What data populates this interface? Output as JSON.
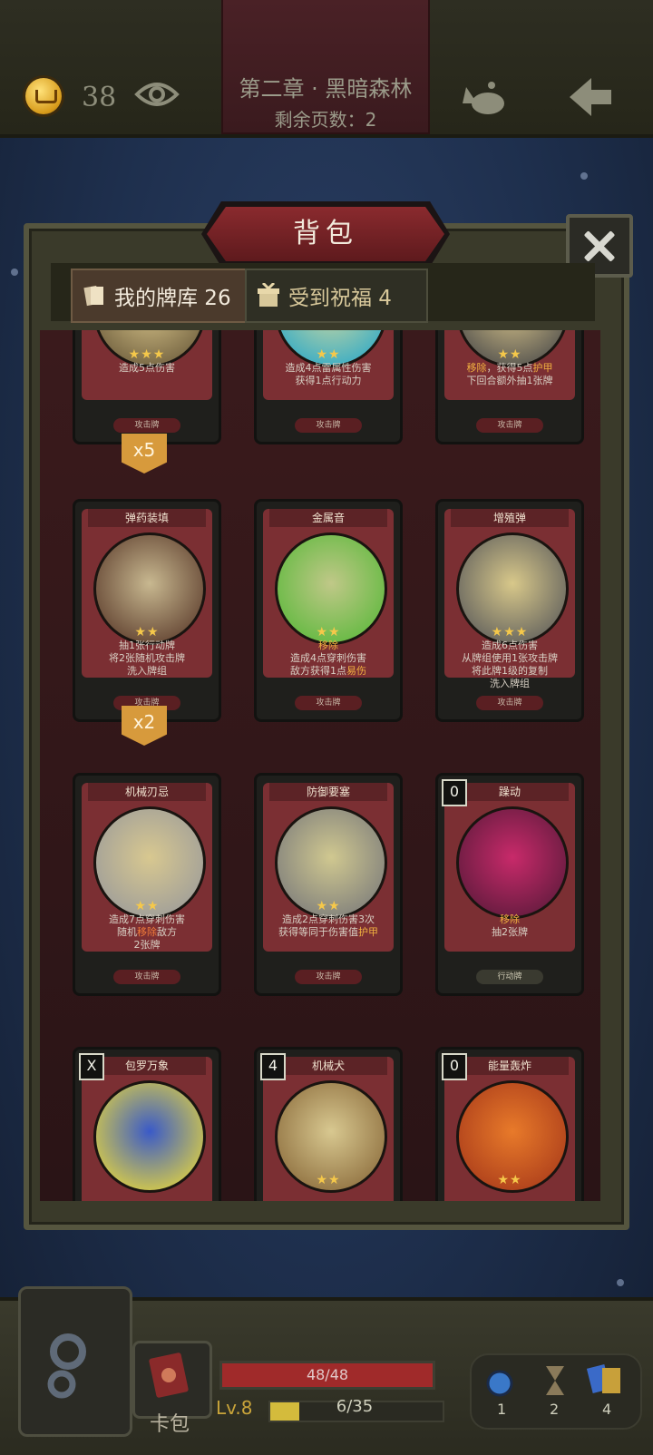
{
  "header": {
    "coins": "38",
    "chapter_title": "第二章 · 黑暗森林",
    "pages_left": "剩余页数：2"
  },
  "panel": {
    "title": "背包",
    "tabs": [
      {
        "label": "我的牌库 26"
      },
      {
        "label": "受到祝福 4"
      }
    ]
  },
  "cards": [
    {
      "name": "",
      "stars": "★★★",
      "desc_html": "造成5点伤害",
      "type": "攻击牌"
    },
    {
      "name": "",
      "stars": "★★",
      "desc_html": "造成4点雷属性伤害<br>获得1点行动力",
      "type": "攻击牌"
    },
    {
      "name": "",
      "stars": "★★",
      "desc_html": "<span class=\"hl\">移除</span>，获得5点<span class=\"hl\">护甲</span><br>下回合额外抽1张牌",
      "type": "攻击牌"
    },
    {
      "name": "弹药装填",
      "stars": "★★",
      "desc_html": "抽1张行动牌<br>将2张随机攻击牌<br>洗入牌组",
      "type": "攻击牌"
    },
    {
      "name": "金属音",
      "stars": "★★",
      "desc_html": "<span class=\"hl\">移除</span><br>造成4点穿刺伤害<br>敌方获得1点<span class=\"hl\">易伤</span>",
      "type": "攻击牌"
    },
    {
      "name": "增殖弹",
      "stars": "★★★",
      "desc_html": "造成6点伤害<br>从牌组使用1张攻击牌<br>将此牌1级的复制<br>洗入牌组",
      "type": "攻击牌"
    },
    {
      "name": "机械刃忌",
      "stars": "★★",
      "desc_html": "造成7点穿刺伤害<br>随机<span class=\"hl-red\">移除</span>敌方<br>2张牌",
      "type": "攻击牌"
    },
    {
      "name": "防御要塞",
      "stars": "★★",
      "desc_html": "造成2点穿刺伤害3次<br>获得等同于伤害值<span class=\"hl\">护甲</span>",
      "type": "攻击牌"
    },
    {
      "name": "躁动",
      "cost": "0",
      "stars": "",
      "desc_html": "<span class=\"hl\">移除</span><br>抽2张牌",
      "type": "行动牌"
    },
    {
      "name": "包罗万象",
      "cost": "X",
      "stars": "",
      "desc_html": "",
      "type": ""
    },
    {
      "name": "机械犬",
      "cost": "4",
      "stars": "★★",
      "desc_html": "",
      "type": ""
    },
    {
      "name": "能量轰炸",
      "cost": "0",
      "stars": "★★",
      "desc_html": "",
      "type": ""
    }
  ],
  "badges": [
    "x5",
    "x2"
  ],
  "footer": {
    "deck_label": "卡包",
    "hp": "48/48",
    "hp_ratio": 1.0,
    "level": "Lv.8",
    "xp": "6/35",
    "xp_ratio": 0.17,
    "items": [
      "1",
      "2",
      "4"
    ]
  }
}
